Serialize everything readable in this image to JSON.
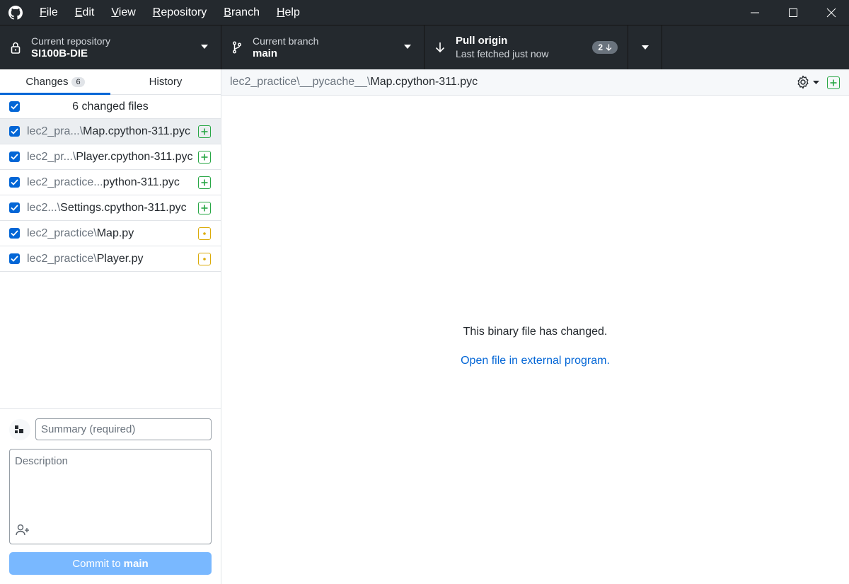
{
  "menu": {
    "items": [
      {
        "accel": "F",
        "rest": "ile"
      },
      {
        "accel": "E",
        "rest": "dit"
      },
      {
        "accel": "V",
        "rest": "iew"
      },
      {
        "accel": "R",
        "rest": "epository"
      },
      {
        "accel": "B",
        "rest": "ranch"
      },
      {
        "accel": "H",
        "rest": "elp"
      }
    ]
  },
  "toolbar": {
    "repo_label": "Current repository",
    "repo_value": "SI100B-DIE",
    "branch_label": "Current branch",
    "branch_value": "main",
    "pull_label": "Pull origin",
    "pull_sub": "Last fetched just now",
    "pull_count": "2"
  },
  "tabs": {
    "changes_label": "Changes",
    "changes_count": "6",
    "history_label": "History"
  },
  "files": {
    "header": "6 changed files",
    "rows": [
      {
        "dim": "lec2_pra...\\",
        "name": "Map.cpython-311.pyc",
        "status": "added"
      },
      {
        "dim": "lec2_pr...\\",
        "name": "Player.cpython-311.pyc",
        "status": "added"
      },
      {
        "dim": "lec2_practice...",
        "name": "python-311.pyc",
        "status": "added"
      },
      {
        "dim": "lec2...\\",
        "name": "Settings.cpython-311.pyc",
        "status": "added"
      },
      {
        "dim": "lec2_practice\\",
        "name": "Map.py",
        "status": "modified"
      },
      {
        "dim": "lec2_practice\\",
        "name": "Player.py",
        "status": "modified"
      }
    ]
  },
  "commit": {
    "summary_placeholder": "Summary (required)",
    "description_placeholder": "Description",
    "button_prefix": "Commit to",
    "button_branch": "main"
  },
  "main": {
    "path_dim": "lec2_practice\\__pycache__\\",
    "path_file": "Map.cpython-311.pyc",
    "binary_message": "This binary file has changed.",
    "open_link": "Open file in external program."
  },
  "colors": {
    "accent": "#0366d6",
    "added": "#28a745",
    "modified": "#dbab09",
    "chrome": "#24292e"
  }
}
